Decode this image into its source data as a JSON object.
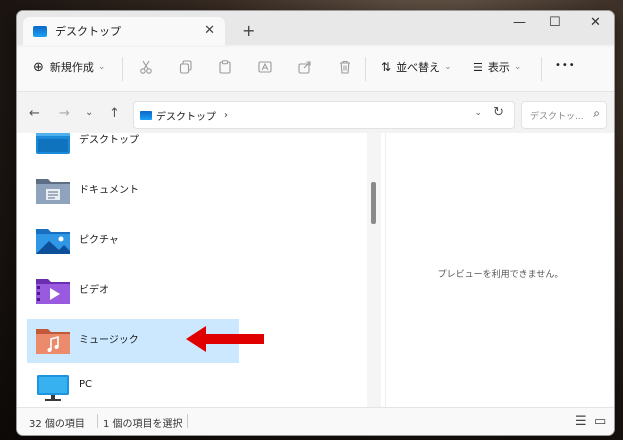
{
  "tab": {
    "title": "デスクトップ",
    "close": "✕",
    "new_tab": "+"
  },
  "window_controls": {
    "minimize": "—",
    "maximize": "☐",
    "close": "✕"
  },
  "toolbar": {
    "new_icon": "⊕",
    "new_label": "新規作成",
    "new_chevron": "⌄",
    "sort_icon": "⇅",
    "sort_label": "並べ替え",
    "sort_chevron": "⌄",
    "view_icon": "☰",
    "view_label": "表示",
    "view_chevron": "⌄",
    "more": "•••"
  },
  "nav": {
    "back": "←",
    "forward": "→",
    "recent": "⌄",
    "up": "↑"
  },
  "address": {
    "path": "デスクトップ",
    "separator": "›",
    "dropdown": "⌄",
    "refresh": "↻"
  },
  "search": {
    "placeholder": "デスクトッ...",
    "icon": "⌕"
  },
  "files": [
    {
      "label": "デスクトップ",
      "icon": "desktop-folder-icon"
    },
    {
      "label": "ドキュメント",
      "icon": "documents-folder-icon"
    },
    {
      "label": "ピクチャ",
      "icon": "pictures-folder-icon"
    },
    {
      "label": "ビデオ",
      "icon": "videos-folder-icon"
    },
    {
      "label": "ミュージック",
      "icon": "music-folder-icon"
    },
    {
      "label": "PC",
      "icon": "pc-icon"
    }
  ],
  "preview": {
    "message": "プレビューを利用できません。"
  },
  "status": {
    "item_count": "32 個の項目",
    "selected": "1 個の項目を選択"
  },
  "colors": {
    "selection": "#cce8ff",
    "annotation_arrow": "#e00000",
    "accent": "#0a67c9"
  }
}
